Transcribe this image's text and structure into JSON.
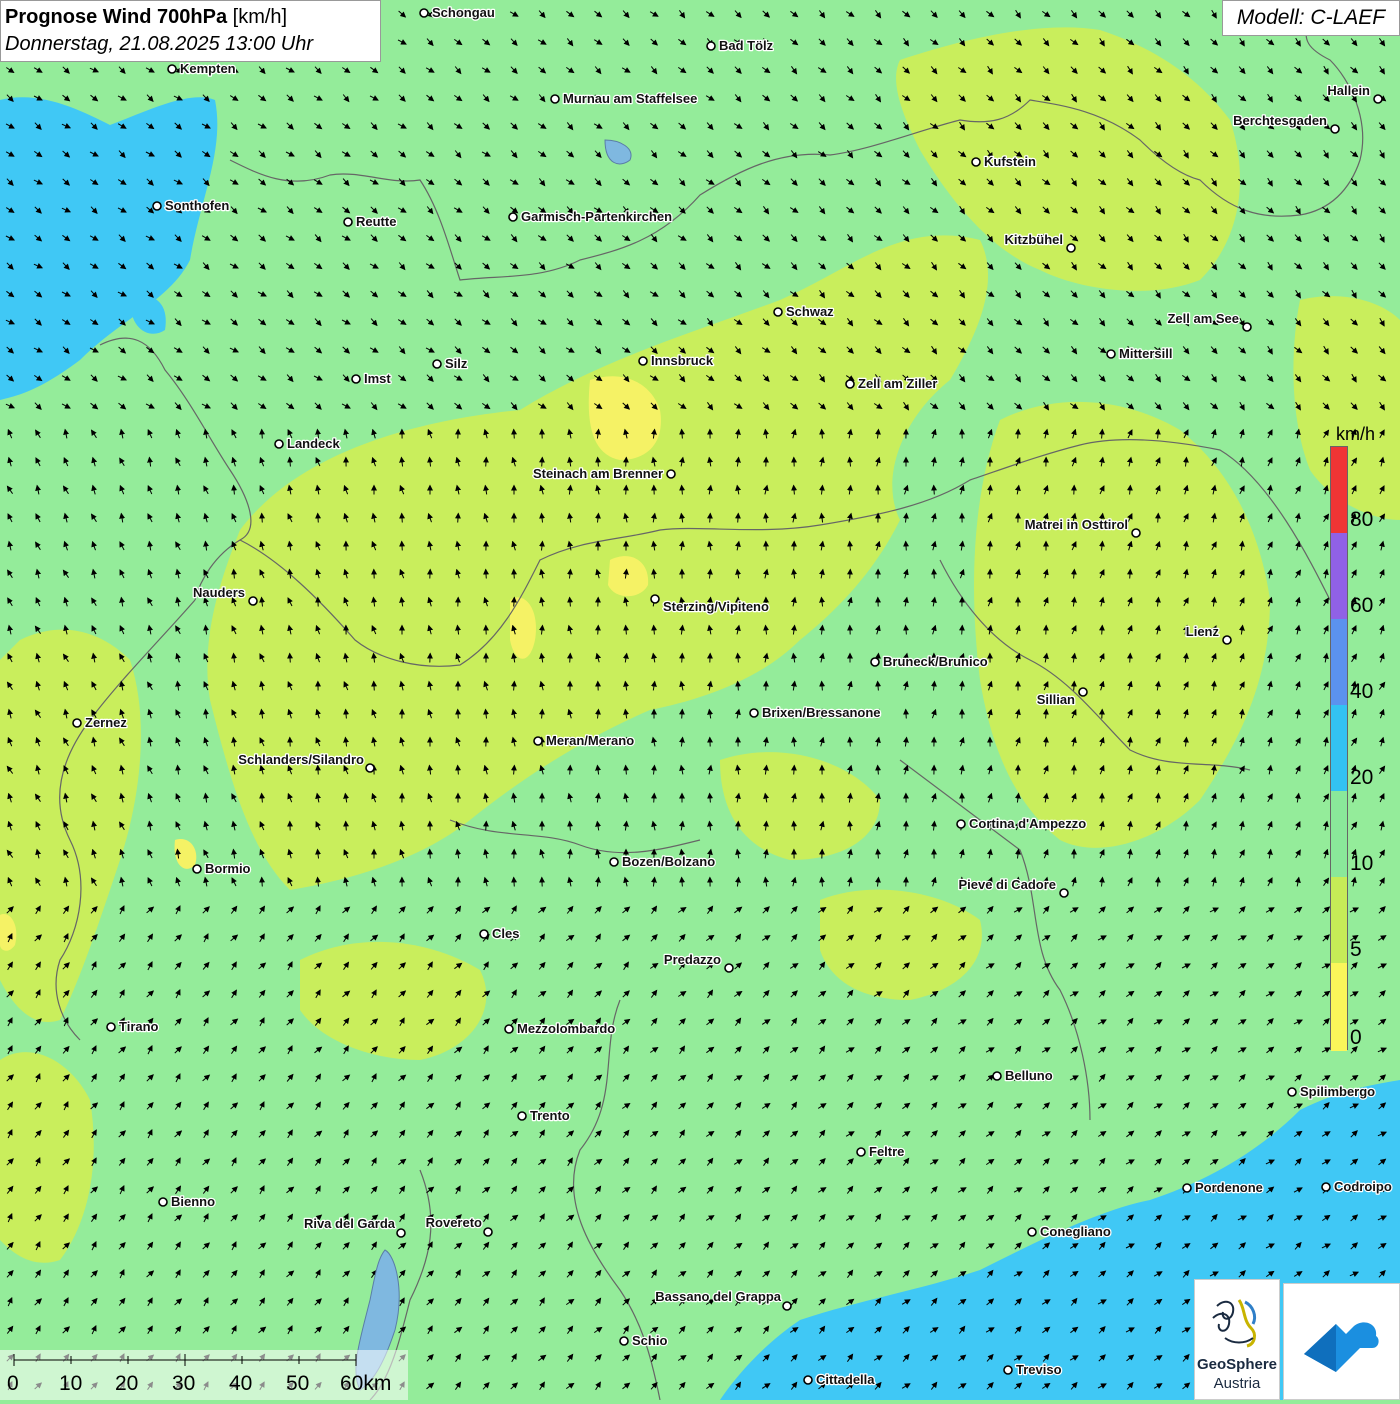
{
  "title": {
    "bold": "Prognose Wind 700hPa",
    "unit": "[km/h]",
    "datetime": "Donnerstag, 21.08.2025 13:00 Uhr"
  },
  "model": "Modell: C-LAEF",
  "legend": {
    "unit": "km/h",
    "labels": [
      "80",
      "60",
      "40",
      "20",
      "10",
      "5",
      "0"
    ],
    "colors": [
      "#f03535",
      "#9061e6",
      "#5b92ef",
      "#33c2f2",
      "#8ae89a",
      "#c6ec57",
      "#faf65a"
    ]
  },
  "scalebar": {
    "labels": [
      "0",
      "10",
      "20",
      "30",
      "40",
      "50",
      "60km"
    ]
  },
  "logos": {
    "geosphere_line1": "GeoSphere",
    "geosphere_line2": "Austria"
  },
  "cities": [
    {
      "name": "Schongau"
    },
    {
      "name": "Bad Tölz"
    },
    {
      "name": "Kempten"
    },
    {
      "name": "Murnau am Staffelsee"
    },
    {
      "name": "Hallein"
    },
    {
      "name": "Berchtesgaden"
    },
    {
      "name": "Kufstein"
    },
    {
      "name": "Sonthofen"
    },
    {
      "name": "Reutte"
    },
    {
      "name": "Garmisch-Partenkirchen"
    },
    {
      "name": "Kitzbühel"
    },
    {
      "name": "Schwaz"
    },
    {
      "name": "Zell am See"
    },
    {
      "name": "Innsbruck"
    },
    {
      "name": "Mittersill"
    },
    {
      "name": "Imst"
    },
    {
      "name": "Silz"
    },
    {
      "name": "Zell am Ziller"
    },
    {
      "name": "Landeck"
    },
    {
      "name": "Steinach am Brenner"
    },
    {
      "name": "Matrei in Osttirol"
    },
    {
      "name": "Nauders"
    },
    {
      "name": "Sterzing/Vipiteno"
    },
    {
      "name": "Lienz"
    },
    {
      "name": "Bruneck/Brunico"
    },
    {
      "name": "Sillian"
    },
    {
      "name": "Brixen/Bressanone"
    },
    {
      "name": "Zernez"
    },
    {
      "name": "Meran/Merano"
    },
    {
      "name": "Schlanders/Silandro"
    },
    {
      "name": "Cortina d'Ampezzo"
    },
    {
      "name": "Bozen/Bolzano"
    },
    {
      "name": "Bormio"
    },
    {
      "name": "Pieve di Cadore"
    },
    {
      "name": "Cles"
    },
    {
      "name": "Predazzo"
    },
    {
      "name": "Tirano"
    },
    {
      "name": "Mezzolombardo"
    },
    {
      "name": "Belluno"
    },
    {
      "name": "Spilimbergo"
    },
    {
      "name": "Trento"
    },
    {
      "name": "Feltre"
    },
    {
      "name": "Pordenone"
    },
    {
      "name": "Codroipo"
    },
    {
      "name": "Bienno"
    },
    {
      "name": "Riva del Garda"
    },
    {
      "name": "Rovereto"
    },
    {
      "name": "Conegliano"
    },
    {
      "name": "Bassano del Grappa"
    },
    {
      "name": "Schio"
    },
    {
      "name": "Treviso"
    },
    {
      "name": "Cittadella"
    }
  ]
}
